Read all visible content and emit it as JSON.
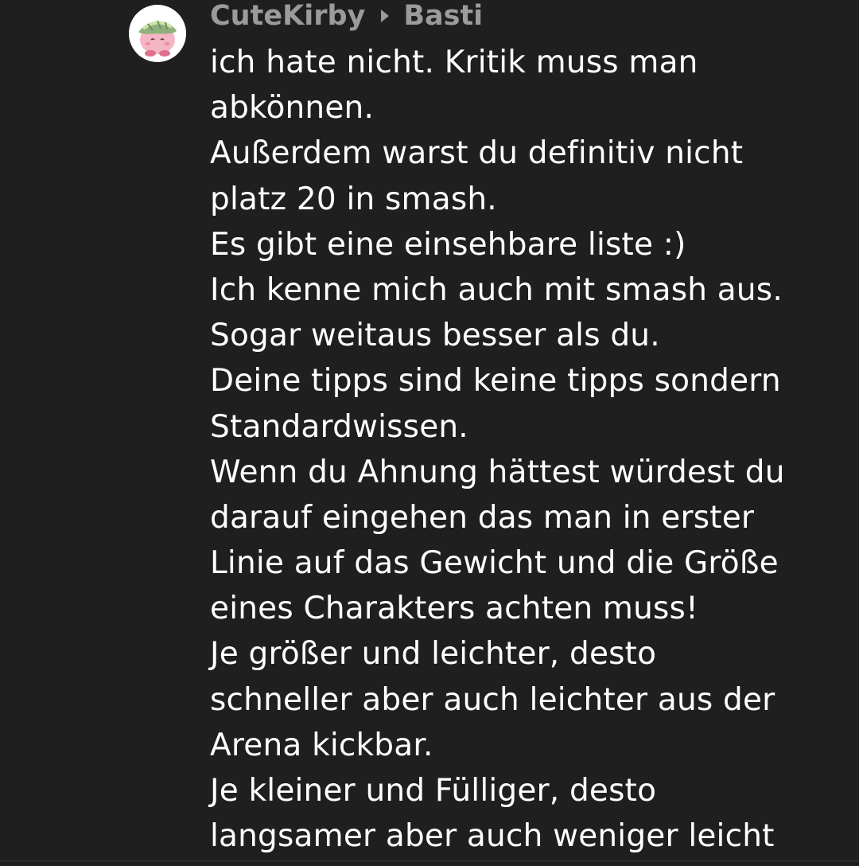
{
  "comment": {
    "author": "CuteKirby",
    "recipient": "Basti",
    "avatar_icon": "kirby-avatar-icon",
    "lines": [
      "ich hate nicht. Kritik muss man",
      "abkönnen.",
      "Außerdem warst du definitiv nicht",
      "platz 20 in smash.",
      "Es gibt eine einsehbare liste :)",
      "Ich kenne mich auch mit smash aus.",
      "Sogar weitaus besser als du.",
      "Deine tipps sind keine tipps sondern",
      "Standardwissen.",
      "Wenn du Ahnung hättest würdest du",
      "darauf eingehen das man in erster",
      "Linie auf das Gewicht und die Größe",
      "eines Charakters achten muss!",
      "Je größer und leichter, desto",
      "schneller aber auch leichter aus der",
      "Arena kickbar.",
      "Je kleiner und Fülliger, desto",
      "langsamer aber auch weniger leicht"
    ]
  },
  "colors": {
    "background": "#1f1f1f",
    "text": "#ffffff",
    "meta_text": "#9b9b9b"
  }
}
